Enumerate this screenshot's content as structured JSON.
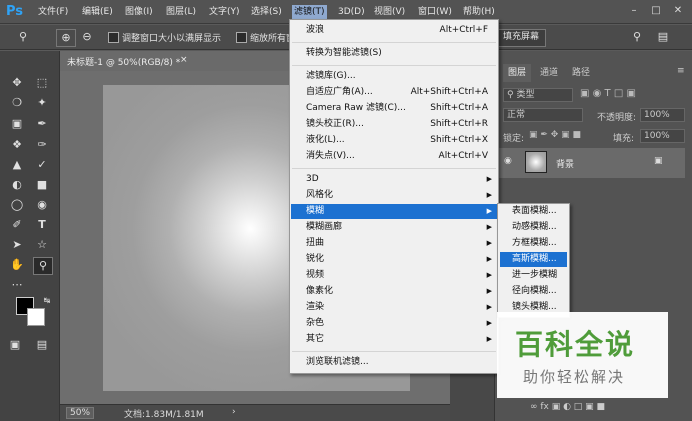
{
  "menubar": {
    "logo": "Ps",
    "items": [
      "文件(F)",
      "编辑(E)",
      "图像(I)",
      "图层(L)",
      "文字(Y)",
      "选择(S)",
      "滤镜(T)",
      "3D(D)",
      "视图(V)",
      "窗口(W)",
      "帮助(H)"
    ],
    "active_item": "滤镜(T)"
  },
  "optionsbar": {
    "resize_label": "调整窗口大小以满屏显示",
    "zoom_all_label": "缩放所有窗",
    "fill_screen_label": "填充屏幕"
  },
  "document": {
    "tab_title": "未标题-1 @ 50%(RGB/8) *",
    "zoom": "50%",
    "doc_info": "文档:1.83M/1.81M"
  },
  "panels": {
    "tabs": [
      "图层",
      "通道",
      "路径"
    ],
    "kind_label": "类型",
    "blend_mode": "正常",
    "opacity_label": "不透明度:",
    "opacity_value": "100%",
    "lock_label": "锁定:",
    "fill_label": "填充:",
    "fill_value": "100%",
    "layer_name": "背景"
  },
  "filter_menu": {
    "items": [
      {
        "label": "波浪",
        "shortcut": "Alt+Ctrl+F"
      },
      {
        "label": "转换为智能滤镜(S)",
        "shortcut": ""
      },
      {
        "label": "滤镜库(G)...",
        "shortcut": ""
      },
      {
        "label": "自适应广角(A)...",
        "shortcut": "Alt+Shift+Ctrl+A"
      },
      {
        "label": "Camera Raw 滤镜(C)...",
        "shortcut": "Shift+Ctrl+A"
      },
      {
        "label": "镜头校正(R)...",
        "shortcut": "Shift+Ctrl+R"
      },
      {
        "label": "液化(L)...",
        "shortcut": "Shift+Ctrl+X"
      },
      {
        "label": "消失点(V)...",
        "shortcut": "Alt+Ctrl+V"
      },
      {
        "label": "3D",
        "shortcut": ""
      },
      {
        "label": "风格化",
        "shortcut": ""
      },
      {
        "label": "模糊",
        "shortcut": ""
      },
      {
        "label": "模糊画廊",
        "shortcut": ""
      },
      {
        "label": "扭曲",
        "shortcut": ""
      },
      {
        "label": "锐化",
        "shortcut": ""
      },
      {
        "label": "视频",
        "shortcut": ""
      },
      {
        "label": "像素化",
        "shortcut": ""
      },
      {
        "label": "渲染",
        "shortcut": ""
      },
      {
        "label": "杂色",
        "shortcut": ""
      },
      {
        "label": "其它",
        "shortcut": ""
      },
      {
        "label": "浏览联机滤镜...",
        "shortcut": ""
      }
    ],
    "highlighted": "模糊"
  },
  "blur_submenu": {
    "items": [
      "表面模糊...",
      "动感模糊...",
      "方框模糊...",
      "高斯模糊...",
      "进一步模糊",
      "径向模糊...",
      "镜头模糊..."
    ],
    "highlighted": "高斯模糊..."
  },
  "watermark": {
    "title": "百科全说",
    "subtitle": "助你轻松解决"
  },
  "colors": {
    "menu_highlight": "#1c71d1",
    "ps_blue": "#2fa3f6",
    "watermark_green": "#4f9c3a"
  }
}
